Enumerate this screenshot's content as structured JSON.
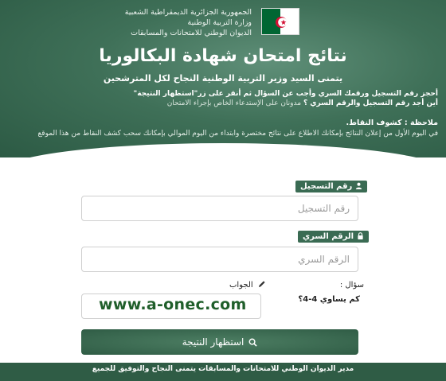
{
  "header": {
    "org_lines": [
      "الجمهورية الجزائرية الديمقراطية الشعبية",
      "وزارة التربية الوطنية",
      "الديوان الوطني للامتحانات والمسابقات"
    ],
    "title": "نتائج امتحان شهادة البكالوريا",
    "subtitle": "يتمنى السيد وزير التربية الوطنية النجاح لكل المترشحين",
    "instructions": {
      "line1": "أحجز رقم التسجيل ورقمك السري وأجب عن السؤال ثم أنقر على زر\"استظهار النتيجة\"",
      "line2_bold": "أين أجد رقم التسجيل والرقم السري ؟",
      "line2_normal": " مدونان على الإستدعاء الخاص بإجراء الامتحان"
    },
    "note": {
      "heading": "ملاحظة : كشوف النقاط.",
      "body": "في اليوم الأول من إعلان النتائج بإمكانك الاطلاع على نتائج مختصرة وابتداء من اليوم الموالي بإمكانك سحب كشف النقاط من هذا الموقع"
    }
  },
  "form": {
    "registration": {
      "label": "رقم التسجيل",
      "placeholder": "رقم التسجيل",
      "value": ""
    },
    "secret": {
      "label": "الرقم السري",
      "placeholder": "الرقم السري",
      "value": ""
    },
    "question": {
      "label": "سؤال :",
      "text": "كم يساوي 4-4؟"
    },
    "answer": {
      "label": "الجواب",
      "value": ""
    },
    "watermark": "www.a-onec.com",
    "submit_label": "استظهار النتيجة"
  },
  "footer": {
    "text": "مدير الديوان الوطني للامتحانات والمسابقات يتمنى النجاح والتوفيق للجميع"
  },
  "colors": {
    "primary": "#3a6b53",
    "dark": "#2f5c45",
    "watermark": "#1f5e2a",
    "flag_red": "#d21034",
    "flag_green": "#006633"
  }
}
